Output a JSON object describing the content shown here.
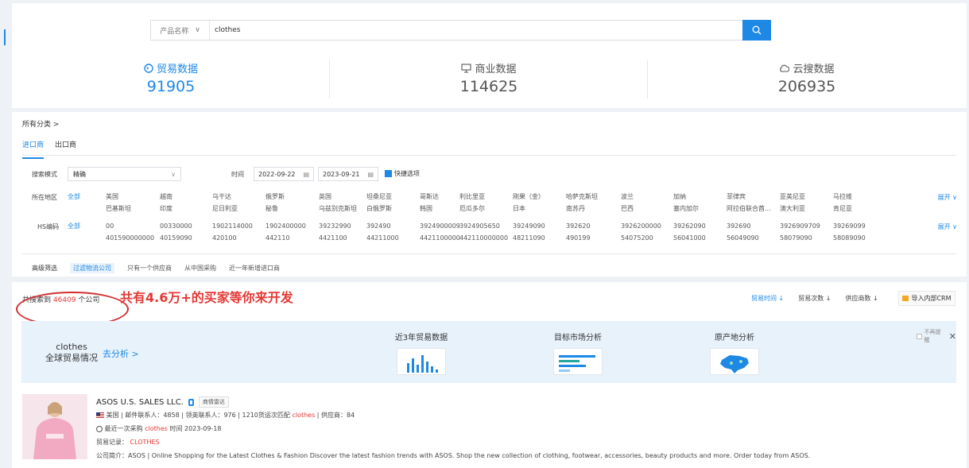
{
  "search": {
    "scope_label": "产品名称",
    "value": "clothes"
  },
  "stats": [
    {
      "label": "贸易数据",
      "value": "91905",
      "icon": "globe-icon"
    },
    {
      "label": "商业数据",
      "value": "114625",
      "icon": "monitor-icon"
    },
    {
      "label": "云搜数据",
      "value": "206935",
      "icon": "cloud-icon"
    }
  ],
  "filters": {
    "category_link": "所有分类 >",
    "tabs": [
      "进口商",
      "出口商"
    ],
    "search_mode_label": "搜索模式",
    "search_mode_value": "精确",
    "time_label": "时间",
    "date_from": "2022-09-22",
    "date_to": "2023-09-21",
    "quick_option": "快捷选项",
    "region_label": "所在地区",
    "all_label": "全部",
    "regions_top": [
      "美国",
      "越南",
      "乌干达",
      "俄罗斯",
      "英国",
      "坦桑尼亚",
      "哥斯达",
      "利比里亚",
      "刚果（金）",
      "哈萨克斯坦",
      "波兰",
      "加纳",
      "菲律宾",
      "亚美尼亚",
      "马拉维"
    ],
    "regions_bottom": [
      "巴基斯坦",
      "印度",
      "尼日利亚",
      "秘鲁",
      "乌兹别克斯坦",
      "白俄罗斯",
      "韩国",
      "厄瓜多尔",
      "日本",
      "南苏丹",
      "巴西",
      "塞内加尔",
      "阿拉伯联合酋...",
      "澳大利亚",
      "肯尼亚"
    ],
    "hs_label": "HS编码",
    "hs_top": [
      "00",
      "00330000",
      "1902114000",
      "1902400000",
      "39232990",
      "392490",
      "3924900009",
      "3924905650",
      "39249090",
      "392620",
      "3926200000",
      "39262090",
      "392690",
      "3926909709",
      "39269099"
    ],
    "hs_bottom": [
      "401590000000",
      "40159090",
      "420100",
      "442110",
      "4421100",
      "44211000",
      "4421100000",
      "442110000000",
      "48211090",
      "490199",
      "54075200",
      "56041000",
      "56049090",
      "58079090",
      "58089090"
    ],
    "expand_label": "展开",
    "advanced": [
      "高级筛选",
      "过滤物流公司",
      "只有一个供应商",
      "从中国采购",
      "近一年新增进口商"
    ]
  },
  "results": {
    "count_prefix": "共搜索到",
    "count_value": "46409",
    "count_suffix": "个公司",
    "promo": "共有4.6万+的买家等你来开发",
    "sorts": [
      "贸易时间 ↓",
      "贸易次数 ↓",
      "供应商数 ↓"
    ],
    "crm_label": "导入内部CRM",
    "analysis": {
      "keyword": "clothes",
      "subtitle": "全球贸易情况",
      "go_label": "去分析 >",
      "cards": [
        "近3年贸易数据",
        "目标市场分析",
        "原产地分析"
      ],
      "no_show": "不再提醒"
    },
    "company": {
      "name": "ASOS U.S. SALES LLC.",
      "radar": "商情雷达",
      "line1_country": "美国",
      "line1_rest": "|  邮件联系人：4858  |  领英联系人：976  |  1210货运次匹配",
      "line1_kw": "clothes",
      "line1_end": "|  供应商：84",
      "line2_pre": "最近一次采购",
      "line2_kw": "clothes",
      "line2_post": "时间 2023-09-18",
      "line3_label": "贸易记录：",
      "line3_value": "CLOTHES",
      "line4": "公司简介：ASOS | Online Shopping for the Latest Clothes & Fashion Discover the latest fashion trends with ASOS. Shop the new collection of clothing, footwear, accessories, beauty products and more. Order today from ASOS."
    }
  },
  "colors": {
    "accent": "#1e88e5",
    "highlight": "#e53935"
  }
}
